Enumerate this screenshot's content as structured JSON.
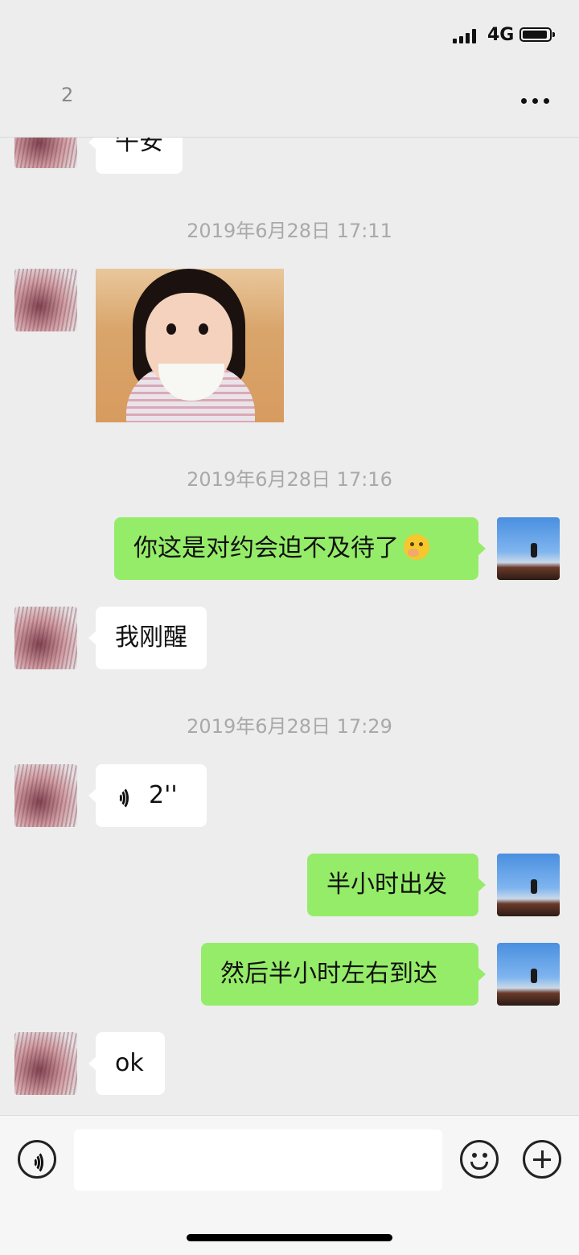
{
  "status_bar": {
    "network": "4G"
  },
  "nav": {
    "unread_count": "2"
  },
  "messages": [
    {
      "kind": "text",
      "side": "other",
      "text": "午安"
    },
    {
      "kind": "timestamp",
      "text": "2019年6月28日 17:11"
    },
    {
      "kind": "image",
      "side": "other"
    },
    {
      "kind": "timestamp",
      "text": "2019年6月28日 17:16"
    },
    {
      "kind": "text",
      "side": "self",
      "text": "你这是对约会迫不及待了",
      "emoji": "shy-face-emoji"
    },
    {
      "kind": "text",
      "side": "other",
      "text": "我刚醒"
    },
    {
      "kind": "timestamp",
      "text": "2019年6月28日 17:29"
    },
    {
      "kind": "voice",
      "side": "other",
      "duration": "2''"
    },
    {
      "kind": "text",
      "side": "self",
      "text": "半小时出发"
    },
    {
      "kind": "text",
      "side": "self",
      "text": "然后半小时左右到达"
    },
    {
      "kind": "text",
      "side": "other",
      "text": "ok"
    }
  ],
  "input_bar": {
    "placeholder": ""
  },
  "colors": {
    "self_bubble": "#95ec69",
    "other_bubble": "#ffffff",
    "background": "#ededed",
    "timestamp": "#a9a9a9"
  },
  "icons": [
    "signal-icon",
    "battery-icon",
    "more-icon",
    "voice-icon",
    "emoji-icon",
    "plus-icon"
  ]
}
